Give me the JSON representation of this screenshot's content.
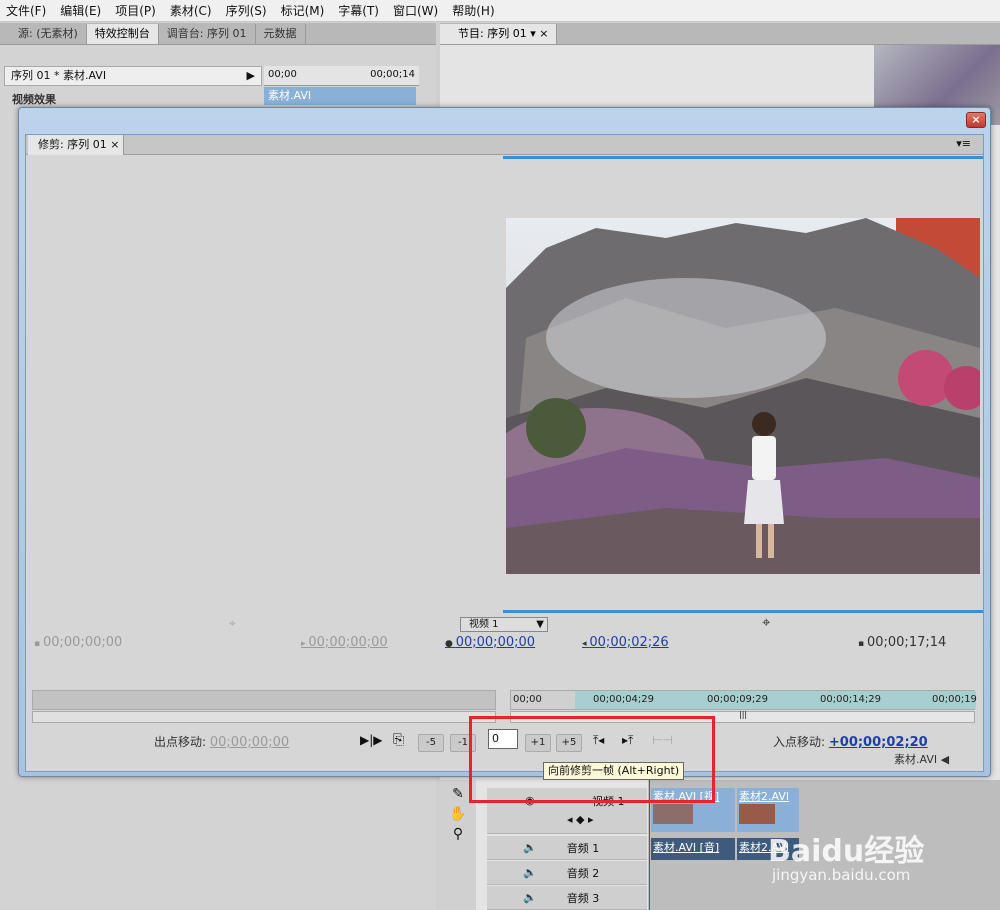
{
  "menu": [
    "文件(F)",
    "编辑(E)",
    "项目(P)",
    "素材(C)",
    "序列(S)",
    "标记(M)",
    "字幕(T)",
    "窗口(W)",
    "帮助(H)"
  ],
  "left_panel": {
    "tabs": [
      "源: (无素材)",
      "特效控制台",
      "调音台: 序列 01",
      "元数据"
    ],
    "sequence_label": "序列 01 * 素材.AVI",
    "section": "视频效果",
    "timecode_start": "00;00",
    "timecode_end": "00;00;14",
    "clip_name": "素材.AVI"
  },
  "program_panel": {
    "tab": "节目: 序列 01"
  },
  "trim": {
    "tab": "修剪: 序列 01",
    "track_select": "视频 1",
    "left_tc1": "00;00;00;00",
    "left_tc2": "00;00;00;00",
    "right_tc1": "00;00;00;00",
    "right_tc2": "00;00;02;26",
    "right_tc3": "00;00;17;14",
    "timeline_ticks": [
      "00;00",
      "00;00;04;29",
      "00;00;09;29",
      "00;00;14;29",
      "00;00;19"
    ],
    "out_shift_label": "出点移动:",
    "out_shift_value": "00;00;00;00",
    "in_shift_label": "入点移动:",
    "in_shift_value": "+00;00;02;20",
    "trim_input_value": "0",
    "btn_minus5": "-5",
    "btn_minus1": "-1",
    "btn_plus1": "+1",
    "btn_plus5": "+5",
    "clip_name": "素材.AVI"
  },
  "tooltip": "向前修剪一帧 (Alt+Right)",
  "tracks": {
    "video1": "视频 1",
    "audio1": "音频 1",
    "audio2": "音频 2",
    "audio3": "音频 3",
    "clip_v1": "素材.AVI [视]",
    "clip_v2": "素材2.AVI",
    "clip_a1": "素材.AVI [音]",
    "clip_a2": "素材2.AVI"
  },
  "watermark": {
    "brand": "Baidu经验",
    "url": "jingyan.baidu.com"
  },
  "colors": {
    "accent_blue": "#3a8fd6",
    "timecode_blue": "#1f3fa8",
    "highlight_red": "#e8232e",
    "clip_blue": "#8ab0d8"
  }
}
